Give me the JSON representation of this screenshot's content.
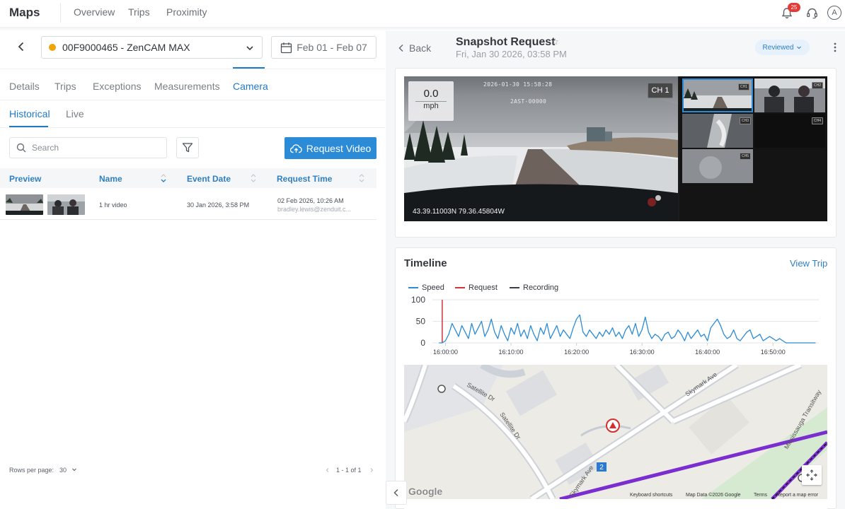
{
  "app": {
    "brand": "Maps",
    "nav": [
      "Overview",
      "Trips",
      "Proximity"
    ],
    "notification_count": "25",
    "avatar_initial": "A"
  },
  "left": {
    "device": "00F9000465 - ZenCAM MAX",
    "device_status_color": "#f0a30a",
    "date_range": "Feb 01 - Feb 07",
    "tabs": [
      "Details",
      "Trips",
      "Exceptions",
      "Measurements",
      "Camera"
    ],
    "active_tab": "Camera",
    "subtabs": [
      "Historical",
      "Live"
    ],
    "active_subtab": "Historical",
    "search_placeholder": "Search",
    "request_video_label": "Request Video",
    "columns": [
      "Preview",
      "Name",
      "Event Date",
      "Request Time"
    ],
    "rows": [
      {
        "name": "1 hr video",
        "event_date": "30 Jan 2026, 3:58 PM",
        "request_time": "02 Feb 2026, 10:26 AM",
        "requested_by": "bradley.lewis@zenduit.c..."
      }
    ],
    "rows_per_page_label": "Rows per page:",
    "rows_per_page": "30",
    "pagination": "1 - 1 of 1"
  },
  "right": {
    "back_label": "Back",
    "title": "Snapshot Request",
    "timestamp": "Fri, Jan 30 2026, 03:58 PM",
    "status": "Reviewed",
    "video": {
      "speed_value": "0.0",
      "speed_unit": "mph",
      "channel": "CH 1",
      "overlay_date": "2026-01-30  15:58:28",
      "overlay_id": "2AST-00000",
      "coordinates": "43.39.11003N  79.36.45804W",
      "thumb_tag": "CH1",
      "thumb_tags": [
        "CH1",
        "CH2",
        "CH3",
        "CH4",
        "CH5"
      ]
    },
    "timeline": {
      "title": "Timeline",
      "view_trip": "View Trip",
      "legend": [
        {
          "name": "Speed",
          "color": "#2b8bd6"
        },
        {
          "name": "Request",
          "color": "#d0323e"
        },
        {
          "name": "Recording",
          "color": "#3a3f45"
        }
      ]
    },
    "map": {
      "streets": [
        "Satellite Dr",
        "Satellite Dr",
        "Skymark Ave",
        "Skymark Ave",
        "Mississauga Transitway"
      ],
      "markers": [
        "2"
      ],
      "attribution": [
        "Keyboard shortcuts",
        "Map Data ©2026 Google",
        "Terms",
        "Report a map error"
      ],
      "logo": "Google"
    }
  },
  "chart_data": {
    "type": "line",
    "series": [
      {
        "name": "Speed",
        "x": [
          "15:59:00",
          "15:59:30",
          "16:00:00",
          "16:00:30",
          "16:01:00",
          "16:01:30",
          "16:02:00",
          "16:02:30",
          "16:03:00",
          "16:03:30",
          "16:04:00",
          "16:04:30",
          "16:05:00",
          "16:05:30",
          "16:06:00",
          "16:06:30",
          "16:07:00",
          "16:07:30",
          "16:08:00",
          "16:08:30",
          "16:09:00",
          "16:09:30",
          "16:10:00",
          "16:10:30",
          "16:11:00",
          "16:11:30",
          "16:12:00",
          "16:12:30",
          "16:13:00",
          "16:13:30",
          "16:14:00",
          "16:14:30",
          "16:15:00",
          "16:15:30",
          "16:16:00",
          "16:16:30",
          "16:17:00",
          "16:17:30",
          "16:18:00",
          "16:18:30",
          "16:19:00",
          "16:19:30",
          "16:20:00",
          "16:20:30",
          "16:21:00",
          "16:21:30",
          "16:22:00",
          "16:22:30",
          "16:23:00",
          "16:23:30",
          "16:24:00",
          "16:24:30",
          "16:25:00",
          "16:25:30",
          "16:26:00",
          "16:26:30",
          "16:27:00",
          "16:27:30",
          "16:28:00",
          "16:28:30",
          "16:29:00",
          "16:29:30",
          "16:30:00",
          "16:30:30",
          "16:31:00",
          "16:31:30",
          "16:32:00",
          "16:32:30",
          "16:33:00",
          "16:33:30",
          "16:34:00",
          "16:34:30",
          "16:35:00",
          "16:35:30",
          "16:36:00",
          "16:36:30",
          "16:37:00",
          "16:37:30",
          "16:38:00",
          "16:38:30",
          "16:39:00",
          "16:39:30",
          "16:40:00",
          "16:40:30",
          "16:41:00",
          "16:41:30",
          "16:42:00",
          "16:42:30",
          "16:43:00",
          "16:43:30",
          "16:44:00",
          "16:44:30",
          "16:45:00",
          "16:45:30",
          "16:46:00",
          "16:46:30",
          "16:47:00",
          "16:47:30",
          "16:48:00",
          "16:48:30",
          "16:49:00",
          "16:49:30",
          "16:50:00",
          "16:50:30",
          "16:51:00",
          "16:51:30",
          "16:52:00",
          "16:52:30",
          "16:53:00",
          "16:53:30",
          "16:54:00",
          "16:54:30",
          "16:55:00",
          "16:55:30",
          "16:56:00",
          "16:56:30"
        ],
        "y": [
          0,
          0,
          5,
          20,
          45,
          30,
          15,
          40,
          25,
          10,
          45,
          20,
          35,
          50,
          15,
          30,
          55,
          25,
          10,
          40,
          20,
          5,
          35,
          20,
          45,
          15,
          30,
          10,
          40,
          20,
          5,
          35,
          20,
          45,
          10,
          25,
          40,
          15,
          30,
          20,
          10,
          35,
          55,
          65,
          25,
          15,
          30,
          20,
          10,
          25,
          15,
          30,
          20,
          35,
          15,
          25,
          10,
          30,
          40,
          20,
          45,
          15,
          30,
          60,
          25,
          10,
          20,
          15,
          5,
          20,
          25,
          10,
          15,
          30,
          20,
          5,
          25,
          10,
          20,
          30,
          15,
          20,
          5,
          35,
          45,
          55,
          40,
          20,
          10,
          15,
          30,
          10,
          5,
          15,
          25,
          30,
          10,
          15,
          20,
          5,
          10,
          15,
          10,
          5,
          10,
          5,
          0,
          0,
          0,
          0,
          0,
          0,
          0,
          0,
          0,
          0
        ]
      }
    ],
    "request_marker_x": "15:59:30",
    "x_ticks": [
      "16:00:00",
      "16:10:00",
      "16:20:00",
      "16:30:00",
      "16:40:00",
      "16:50:00"
    ],
    "y_ticks": [
      0,
      50,
      100
    ],
    "ylim": [
      0,
      100
    ],
    "grid": true,
    "legend_position": "top-left"
  }
}
